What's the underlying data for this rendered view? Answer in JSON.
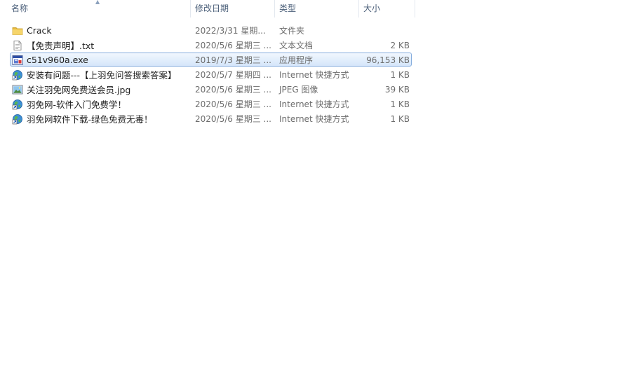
{
  "columns": {
    "name": "名称",
    "date": "修改日期",
    "type": "类型",
    "size": "大小"
  },
  "files": [
    {
      "name": "Crack",
      "date": "2022/3/31 星期...",
      "type": "文件夹",
      "size": "",
      "icon": "folder-icon",
      "selected": false
    },
    {
      "name": "【免责声明】.txt",
      "date": "2020/5/6 星期三 ...",
      "type": "文本文档",
      "size": "2 KB",
      "icon": "text-file-icon",
      "selected": false
    },
    {
      "name": "c51v960a.exe",
      "date": "2019/7/3 星期三 ...",
      "type": "应用程序",
      "size": "96,153 KB",
      "icon": "exe-file-icon",
      "selected": true
    },
    {
      "name": "安装有问题---【上羽免问答搜索答案】",
      "date": "2020/5/7 星期四 ...",
      "type": "Internet 快捷方式",
      "size": "1 KB",
      "icon": "internet-shortcut-icon",
      "selected": false
    },
    {
      "name": "关注羽免网免费送会员.jpg",
      "date": "2020/5/6 星期三 ...",
      "type": "JPEG 图像",
      "size": "39 KB",
      "icon": "image-file-icon",
      "selected": false
    },
    {
      "name": "羽免网-软件入门免费学！",
      "date": "2020/5/6 星期三 ...",
      "type": "Internet 快捷方式",
      "size": "1 KB",
      "icon": "internet-shortcut-icon",
      "selected": false
    },
    {
      "name": "羽免网软件下载-绿色免费无毒！",
      "date": "2020/5/6 星期三 ...",
      "type": "Internet 快捷方式",
      "size": "1 KB",
      "icon": "internet-shortcut-icon",
      "selected": false
    }
  ],
  "colors": {
    "header_text": "#4c607a",
    "selection_border": "#84acdd",
    "selection_fill": "#d5e6fa",
    "meta_text": "#6d6d6d"
  }
}
